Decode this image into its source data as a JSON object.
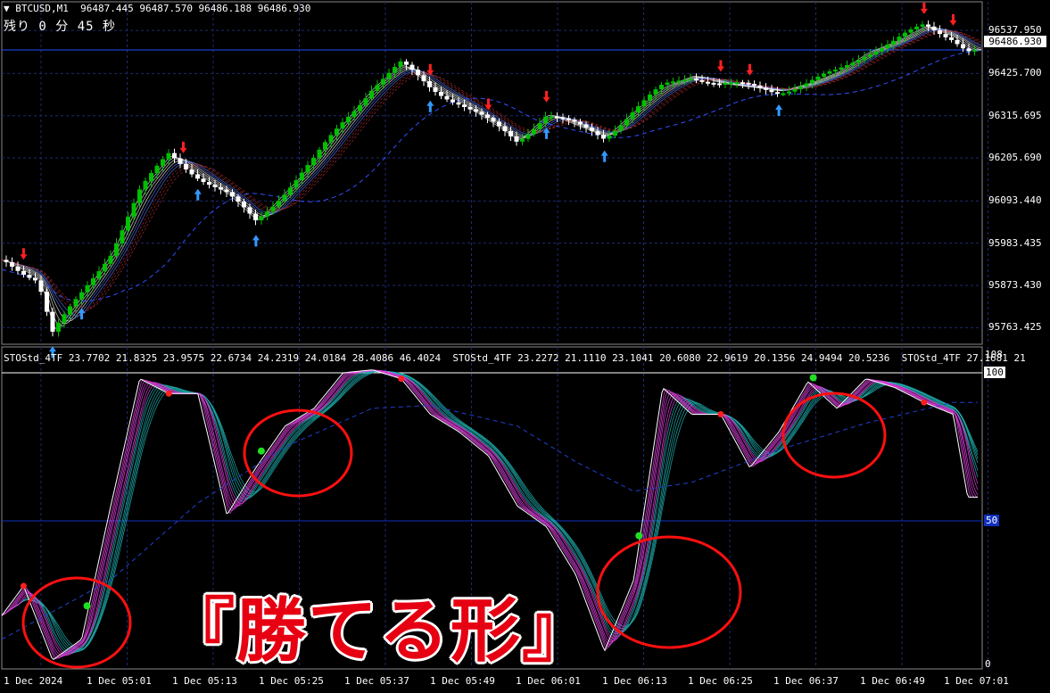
{
  "header": {
    "symbol": "BTCUSD,M1",
    "ohlc": "96487.445 96487.570 96486.188 96486.930",
    "timer": "残り 0 分 45 秒"
  },
  "current_price": "96486.930",
  "price_axis": [
    "96537.950",
    "96425.700",
    "96315.695",
    "96205.690",
    "96093.440",
    "95983.435",
    "95873.430",
    "95763.425"
  ],
  "time_axis": [
    "1 Dec 2024",
    "1 Dec 05:01",
    "1 Dec 05:13",
    "1 Dec 05:25",
    "1 Dec 05:37",
    "1 Dec 05:49",
    "1 Dec 06:01",
    "1 Dec 06:13",
    "1 Dec 06:25",
    "1 Dec 06:37",
    "1 Dec 06:49",
    "1 Dec 07:01"
  ],
  "indicator": {
    "label": "STOStd_4TF 23.7702 21.8325 23.9575 22.6734 24.2319 24.0184 28.4086 46.4024  STOStd_4TF 23.2272 21.1110 23.1041 20.6080 22.9619 20.1356 24.9494 20.5236  STOStd_4TF 27.1681 21",
    "scale_top": "108",
    "scale_100": "100",
    "scale_50": "50",
    "scale_0": "0"
  },
  "annotation": "『勝てる形』",
  "colors": {
    "background": "#000000",
    "grid": "#1e2a6e",
    "bull": "#00c000",
    "bear": "#ffffff",
    "up_arrow": "#3399ff",
    "down_arrow": "#ff2020",
    "stoch_fast": "#e040e0",
    "stoch_slow": "#20b0b0",
    "circle": "#ff1010",
    "annotation": "#e60012"
  },
  "chart_data": [
    {
      "type": "candlestick",
      "title": "BTCUSD,M1",
      "ylim": [
        95720,
        96580
      ],
      "x_range": [
        "1 Dec 2024 04:50",
        "1 Dec 2024 07:05"
      ],
      "close_path": [
        {
          "t": "04:50",
          "price": 95940
        },
        {
          "t": "04:55",
          "price": 95890
        },
        {
          "t": "04:57",
          "price": 95750
        },
        {
          "t": "05:01",
          "price": 95850
        },
        {
          "t": "05:05",
          "price": 95960
        },
        {
          "t": "05:09",
          "price": 96120
        },
        {
          "t": "05:13",
          "price": 96215
        },
        {
          "t": "05:17",
          "price": 96160
        },
        {
          "t": "05:21",
          "price": 96110
        },
        {
          "t": "05:25",
          "price": 96040
        },
        {
          "t": "05:29",
          "price": 96120
        },
        {
          "t": "05:33",
          "price": 96200
        },
        {
          "t": "05:37",
          "price": 96300
        },
        {
          "t": "05:41",
          "price": 96390
        },
        {
          "t": "05:45",
          "price": 96450
        },
        {
          "t": "05:49",
          "price": 96390
        },
        {
          "t": "05:53",
          "price": 96350
        },
        {
          "t": "05:57",
          "price": 96300
        },
        {
          "t": "06:01",
          "price": 96250
        },
        {
          "t": "06:05",
          "price": 96320
        },
        {
          "t": "06:09",
          "price": 96290
        },
        {
          "t": "06:13",
          "price": 96260
        },
        {
          "t": "06:17",
          "price": 96330
        },
        {
          "t": "06:21",
          "price": 96390
        },
        {
          "t": "06:25",
          "price": 96420
        },
        {
          "t": "06:29",
          "price": 96400
        },
        {
          "t": "06:33",
          "price": 96390
        },
        {
          "t": "06:37",
          "price": 96380
        },
        {
          "t": "06:41",
          "price": 96400
        },
        {
          "t": "06:45",
          "price": 96430
        },
        {
          "t": "06:49",
          "price": 96480
        },
        {
          "t": "06:53",
          "price": 96510
        },
        {
          "t": "06:57",
          "price": 96550
        },
        {
          "t": "07:01",
          "price": 96520
        },
        {
          "t": "07:03",
          "price": 96487
        }
      ]
    },
    {
      "type": "line",
      "title": "STOStd_4TF",
      "ylim": [
        0,
        108
      ],
      "levels": [
        0,
        50,
        100
      ],
      "series": [
        {
          "name": "STOStd_4TF",
          "points": [
            {
              "t": "04:50",
              "v": 18
            },
            {
              "t": "04:53",
              "v": 28
            },
            {
              "t": "04:57",
              "v": 3
            },
            {
              "t": "05:01",
              "v": 10
            },
            {
              "t": "05:05",
              "v": 55
            },
            {
              "t": "05:09",
              "v": 98
            },
            {
              "t": "05:13",
              "v": 93
            },
            {
              "t": "05:17",
              "v": 93
            },
            {
              "t": "05:21",
              "v": 52
            },
            {
              "t": "05:25",
              "v": 68
            },
            {
              "t": "05:29",
              "v": 82
            },
            {
              "t": "05:33",
              "v": 88
            },
            {
              "t": "05:37",
              "v": 100
            },
            {
              "t": "05:41",
              "v": 101
            },
            {
              "t": "05:45",
              "v": 98
            },
            {
              "t": "05:49",
              "v": 86
            },
            {
              "t": "05:53",
              "v": 80
            },
            {
              "t": "05:57",
              "v": 72
            },
            {
              "t": "06:01",
              "v": 55
            },
            {
              "t": "06:05",
              "v": 48
            },
            {
              "t": "06:09",
              "v": 32
            },
            {
              "t": "06:13",
              "v": 6
            },
            {
              "t": "06:17",
              "v": 30
            },
            {
              "t": "06:21",
              "v": 95
            },
            {
              "t": "06:25",
              "v": 86
            },
            {
              "t": "06:29",
              "v": 86
            },
            {
              "t": "06:33",
              "v": 68
            },
            {
              "t": "06:37",
              "v": 80
            },
            {
              "t": "06:41",
              "v": 97
            },
            {
              "t": "06:45",
              "v": 88
            },
            {
              "t": "06:49",
              "v": 98
            },
            {
              "t": "06:53",
              "v": 95
            },
            {
              "t": "06:57",
              "v": 90
            },
            {
              "t": "07:01",
              "v": 86
            },
            {
              "t": "07:03",
              "v": 58
            }
          ]
        },
        {
          "name": "STOStd_4TF",
          "points": [
            {
              "t": "04:50",
              "v": 10
            },
            {
              "t": "05:05",
              "v": 30
            },
            {
              "t": "05:17",
              "v": 56
            },
            {
              "t": "05:29",
              "v": 75
            },
            {
              "t": "05:41",
              "v": 88
            },
            {
              "t": "05:49",
              "v": 89
            },
            {
              "t": "06:01",
              "v": 82
            },
            {
              "t": "06:09",
              "v": 70
            },
            {
              "t": "06:17",
              "v": 60
            },
            {
              "t": "06:25",
              "v": 63
            },
            {
              "t": "06:37",
              "v": 74
            },
            {
              "t": "06:49",
              "v": 83
            },
            {
              "t": "07:01",
              "v": 90
            }
          ]
        }
      ]
    }
  ]
}
